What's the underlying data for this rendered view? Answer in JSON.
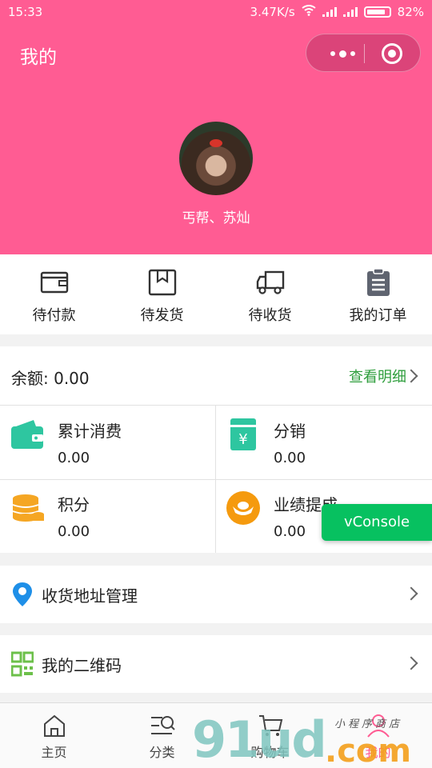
{
  "status_bar": {
    "time": "15:33",
    "speed": "3.47K/s",
    "battery": "82%"
  },
  "header": {
    "title": "我的",
    "user_name": "丐帮、苏灿"
  },
  "orders": [
    {
      "label": "待付款",
      "icon": "wallet-icon"
    },
    {
      "label": "待发货",
      "icon": "box-icon"
    },
    {
      "label": "待收货",
      "icon": "truck-icon"
    },
    {
      "label": "我的订单",
      "icon": "clipboard-icon"
    }
  ],
  "balance": {
    "label": "余额: 0.00",
    "detail_link": "查看明细"
  },
  "stats": [
    {
      "name": "累计消费",
      "value": "0.00",
      "icon": "wallet-green-icon",
      "color": "#2ec6a0"
    },
    {
      "name": "分销",
      "value": "0.00",
      "icon": "yuan-card-icon",
      "color": "#2ec6a0"
    },
    {
      "name": "积分",
      "value": "0.00",
      "icon": "coins-icon",
      "color": "#f5a623"
    },
    {
      "name": "业绩提成",
      "value": "0.00",
      "icon": "ingot-icon",
      "color": "#f59a0e"
    }
  ],
  "vconsole": "vConsole",
  "menu": {
    "address": "收货地址管理",
    "qrcode": "我的二维码"
  },
  "tabs": [
    {
      "label": "主页",
      "icon": "home-icon"
    },
    {
      "label": "分类",
      "icon": "category-search-icon"
    },
    {
      "label": "购物车",
      "icon": "cart-icon"
    },
    {
      "label": "我的",
      "icon": "user-icon"
    }
  ],
  "watermark": {
    "number": "91ud",
    "domain": ".com",
    "sub": "小程序商店"
  },
  "colors": {
    "brand_pink": "#ff5c93",
    "green": "#07c160",
    "link_green": "#2e9e3c"
  }
}
